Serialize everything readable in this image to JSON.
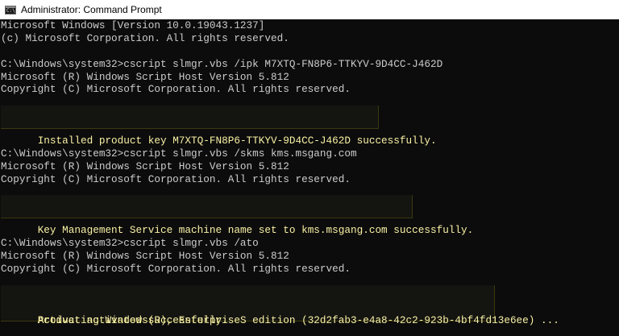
{
  "window": {
    "title": "Administrator: Command Prompt",
    "icon": "cmd-icon",
    "icon_glyph": "C:\\"
  },
  "console": {
    "banner": [
      "Microsoft Windows [Version 10.0.19043.1237]",
      "(c) Microsoft Corporation. All rights reserved."
    ],
    "blocks": [
      {
        "command": "C:\\Windows\\system32>cscript slmgr.vbs /ipk M7XTQ-FN8P6-TTKYV-9D4CC-J462D",
        "output": [
          "Microsoft (R) Windows Script Host Version 5.812",
          "Copyright (C) Microsoft Corporation. All rights reserved."
        ],
        "highlight": [
          "Installed product key M7XTQ-FN8P6-TTKYV-9D4CC-J462D successfully."
        ]
      },
      {
        "command": "C:\\Windows\\system32>cscript slmgr.vbs /skms kms.msgang.com",
        "output": [
          "Microsoft (R) Windows Script Host Version 5.812",
          "Copyright (C) Microsoft Corporation. All rights reserved."
        ],
        "highlight": [
          "Key Management Service machine name set to kms.msgang.com successfully."
        ]
      },
      {
        "command": "C:\\Windows\\system32>cscript slmgr.vbs /ato",
        "output": [
          "Microsoft (R) Windows Script Host Version 5.812",
          "Copyright (C) Microsoft Corporation. All rights reserved."
        ],
        "highlight": [
          "Activating Windows(R), EnterpriseS edition (32d2fab3-e4a8-42c2-923b-4bf4fd13e6ee) ...",
          "Product activated successfully."
        ]
      }
    ]
  },
  "colors": {
    "console_bg": "#0c0c0c",
    "console_text": "#cccccc",
    "highlight_text": "#f9f1a5",
    "titlebar_bg": "#ffffff"
  }
}
